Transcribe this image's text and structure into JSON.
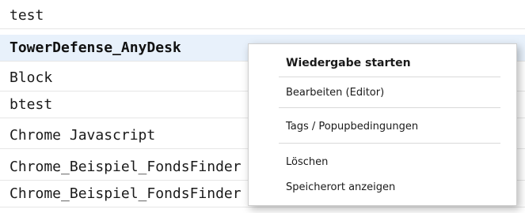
{
  "list": {
    "items": [
      {
        "label": "test"
      },
      {
        "label": "TowerDefense_AnyDesk"
      },
      {
        "label": "Block"
      },
      {
        "label": "btest"
      },
      {
        "label": "Chrome Javascript"
      },
      {
        "label": "Chrome_Beispiel_FondsFinder"
      },
      {
        "label": "Chrome_Beispiel_FondsFinder"
      }
    ]
  },
  "context_menu": {
    "play": "Wiedergabe starten",
    "edit": "Bearbeiten (Editor)",
    "tags": "Tags / Popupbedingungen",
    "delete": "Löschen",
    "show_location": "Speicherort anzeigen"
  },
  "colors": {
    "selection": "#e8f1fb",
    "separator": "#d9d9d9",
    "menu_border": "#cfcfcf"
  }
}
